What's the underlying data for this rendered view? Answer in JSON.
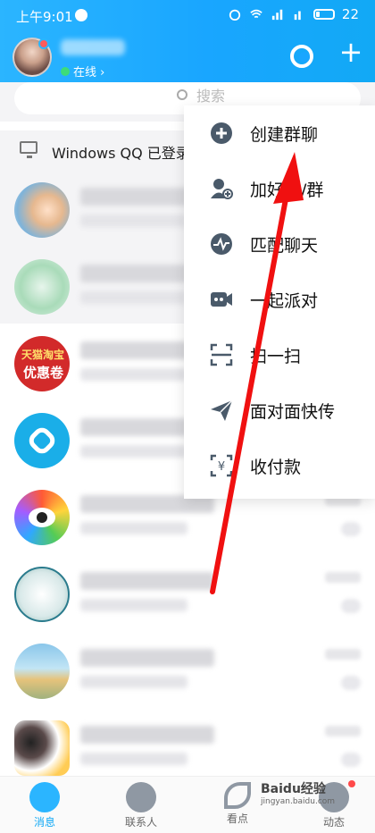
{
  "status_bar": {
    "time": "上午9:01",
    "battery_level": "22"
  },
  "header": {
    "online_label": "在线 ›",
    "moon_icon": "moon-icon",
    "add_icon": "plus-icon"
  },
  "search": {
    "placeholder": "搜索"
  },
  "windows_qq": {
    "label": "Windows QQ 已登录"
  },
  "avatar_text": {
    "taobao_line1": "天猫淘宝",
    "taobao_line2": "优惠卷"
  },
  "menu": {
    "items": [
      {
        "label": "创建群聊",
        "icon": "create-group-icon"
      },
      {
        "label": "加好友/群",
        "icon": "add-friend-icon"
      },
      {
        "label": "匹配聊天",
        "icon": "match-chat-icon"
      },
      {
        "label": "一起派对",
        "icon": "party-icon"
      },
      {
        "label": "扫一扫",
        "icon": "scan-icon"
      },
      {
        "label": "面对面快传",
        "icon": "face-transfer-icon"
      },
      {
        "label": "收付款",
        "icon": "payment-icon"
      }
    ]
  },
  "bottom_nav": {
    "tabs": [
      {
        "label": "消息",
        "icon": "message-icon"
      },
      {
        "label": "联系人",
        "icon": "contacts-icon"
      },
      {
        "label": "看点",
        "icon": "watch-icon"
      },
      {
        "label": "动态",
        "icon": "star-icon"
      }
    ]
  },
  "watermark": {
    "brand": "Baidu经验",
    "sub": "jingyan.baidu.com"
  },
  "colors": {
    "accent": "#12a9f5",
    "arrow": "#f01010"
  }
}
